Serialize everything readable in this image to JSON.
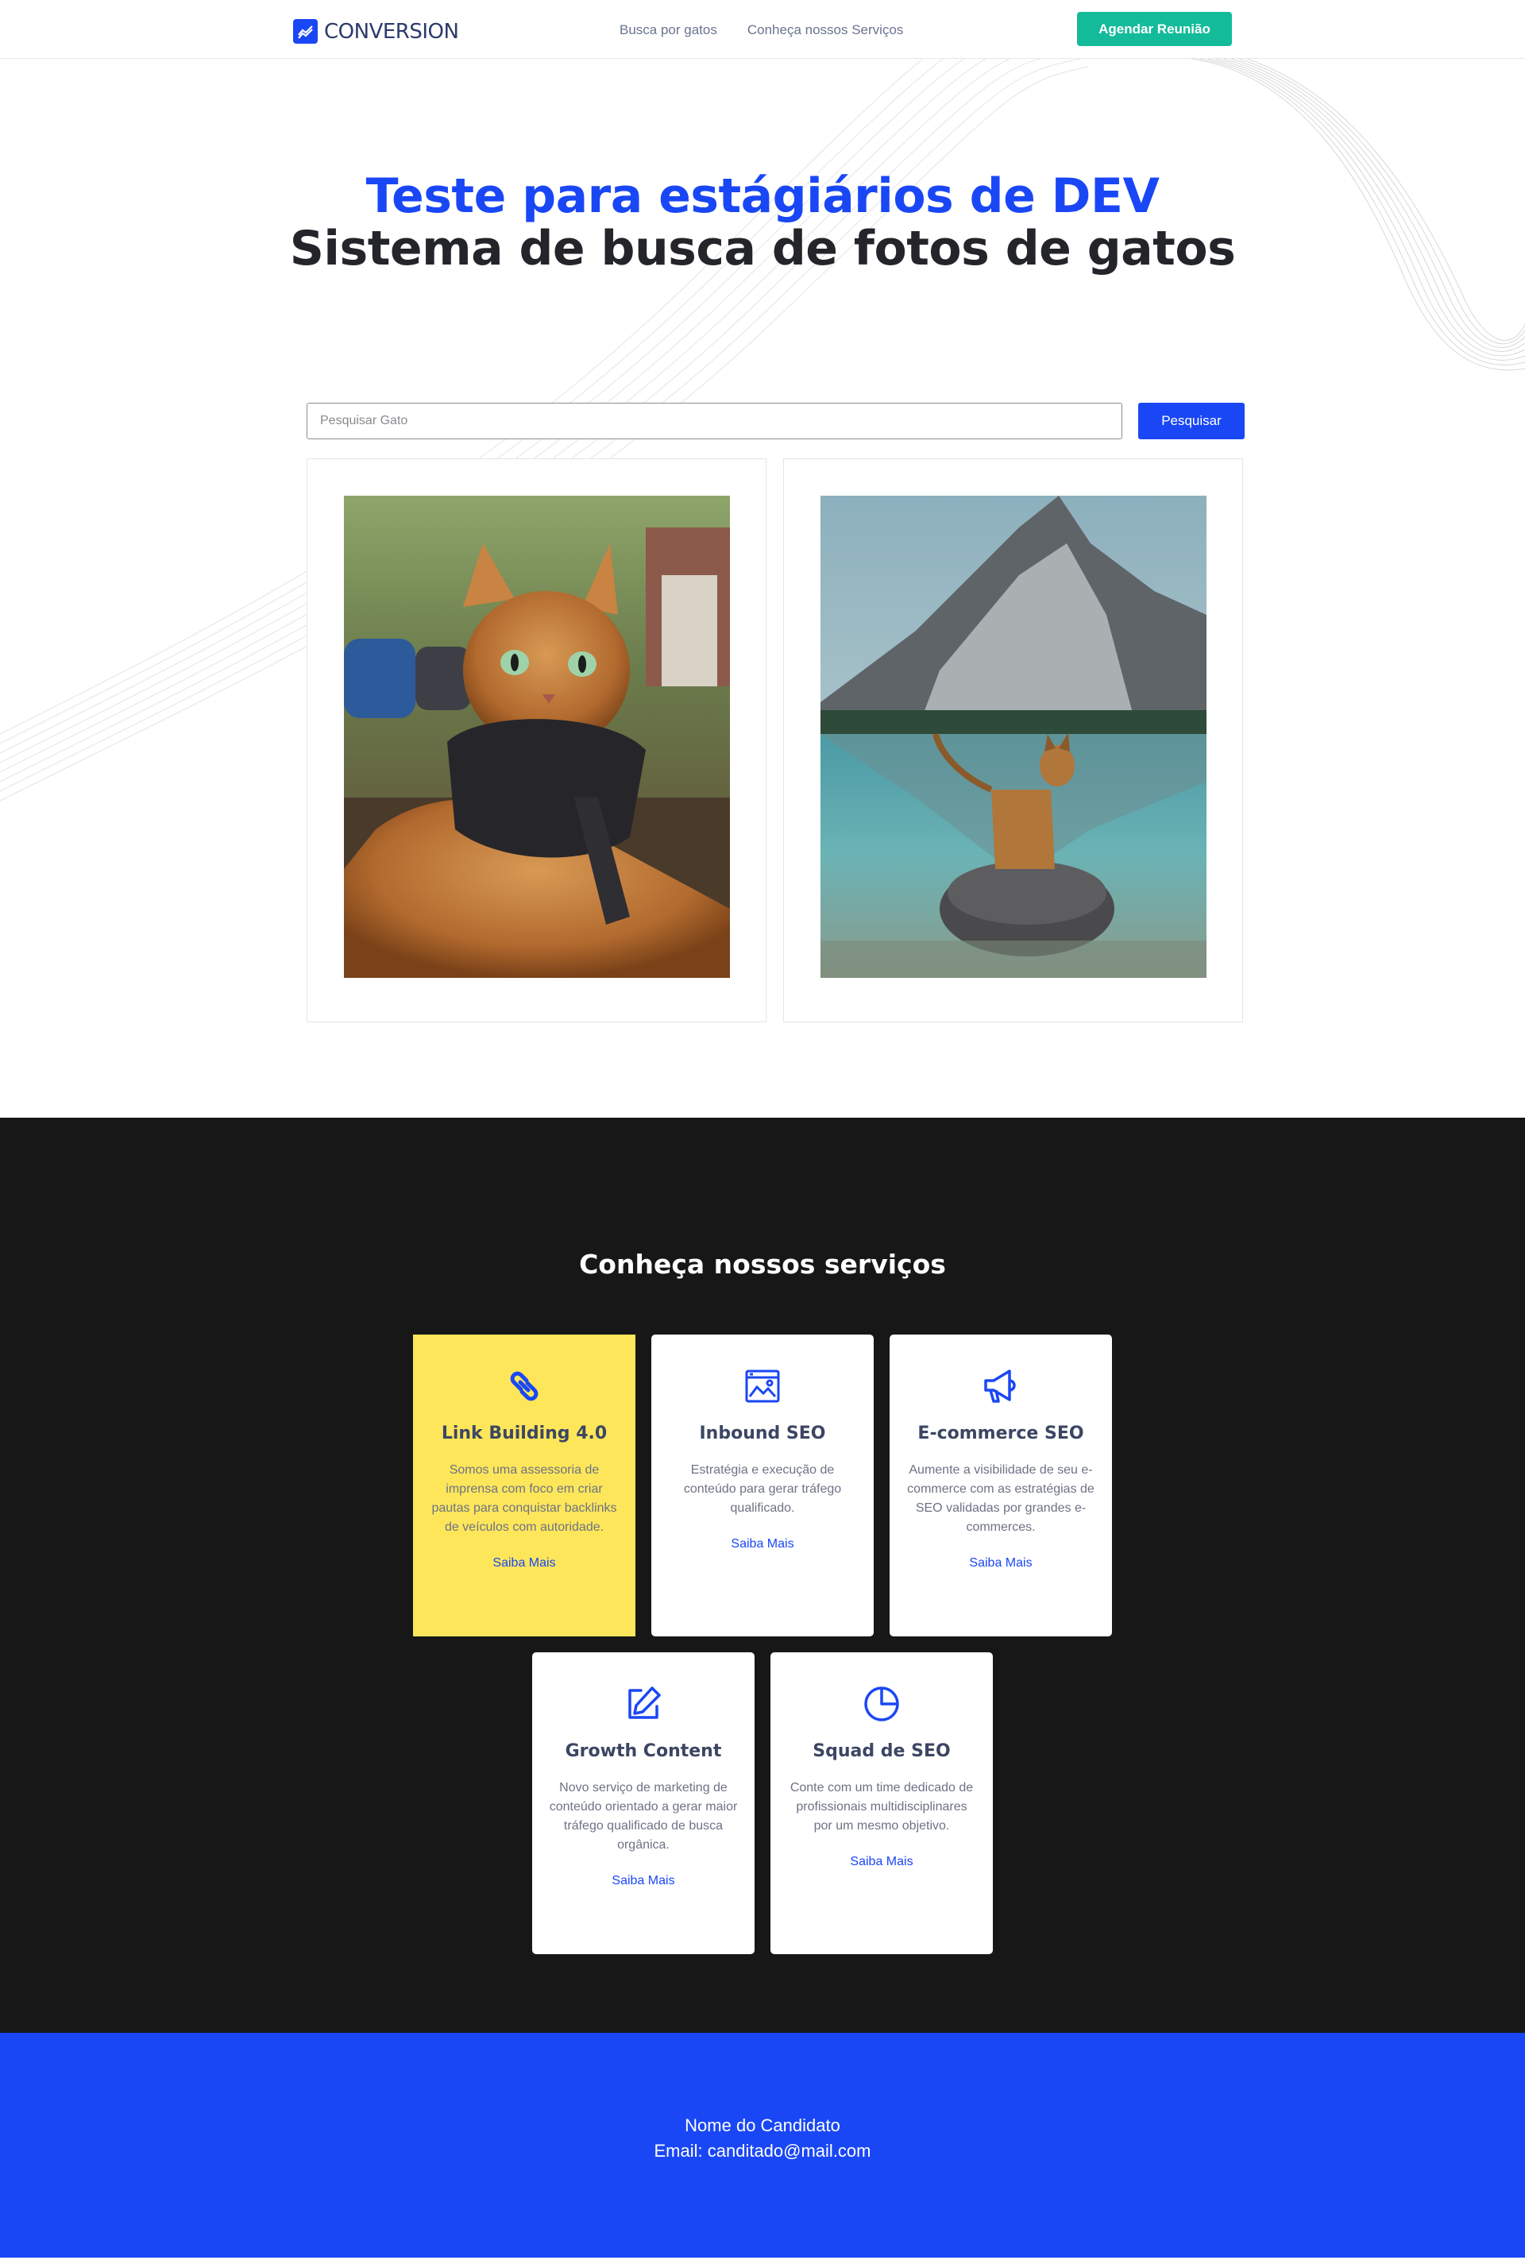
{
  "nav": {
    "logo_text": "CONVERSION",
    "links": [
      "Busca por gatos",
      "Conheça nossos Serviços"
    ],
    "cta_label": "Agendar Reunião"
  },
  "hero": {
    "title_line1": "Teste para estágiários de DEV",
    "title_line2": "Sistema de busca de fotos de gatos"
  },
  "search": {
    "placeholder": "Pesquisar Gato",
    "value": "",
    "button_label": "Pesquisar"
  },
  "results": [
    {
      "alt": "Gato bengal com peitoral preto"
    },
    {
      "alt": "Gato sobre pedra em lago de montanha"
    }
  ],
  "services": {
    "title": "Conheça nossos serviços",
    "items": [
      {
        "icon": "link-icon",
        "title": "Link Building 4.0",
        "desc": "Somos uma assessoria de imprensa com foco em criar pautas para conquistar backlinks de veículos com autoridade.",
        "link": "Saiba Mais",
        "highlight": true
      },
      {
        "icon": "landscape-window-icon",
        "title": "Inbound SEO",
        "desc": "Estratégia e execução de conteúdo para gerar tráfego qualificado.",
        "link": "Saiba Mais",
        "highlight": false
      },
      {
        "icon": "megaphone-icon",
        "title": "E-commerce SEO",
        "desc": "Aumente a visibilidade de seu e-commerce com as estratégias de SEO validadas por grandes e-commerces.",
        "link": "Saiba Mais",
        "highlight": false
      },
      {
        "icon": "edit-icon",
        "title": "Growth Content",
        "desc": "Novo serviço de marketing de conteúdo orientado a gerar maior tráfego qualificado de busca orgânica.",
        "link": "Saiba Mais",
        "highlight": false
      },
      {
        "icon": "pie-chart-icon",
        "title": "Squad de SEO",
        "desc": "Conte com um time dedicado de profissionais multidisciplinares por um mesmo objetivo.",
        "link": "Saiba Mais",
        "highlight": false
      }
    ]
  },
  "footer": {
    "name": "Nome do Candidato",
    "email": "Email: canditado@mail.com"
  },
  "colors": {
    "brand_blue": "#1a47f5",
    "cta_green": "#14bb9a",
    "highlight_yellow": "#fde65a",
    "dark_bg": "#171717"
  }
}
